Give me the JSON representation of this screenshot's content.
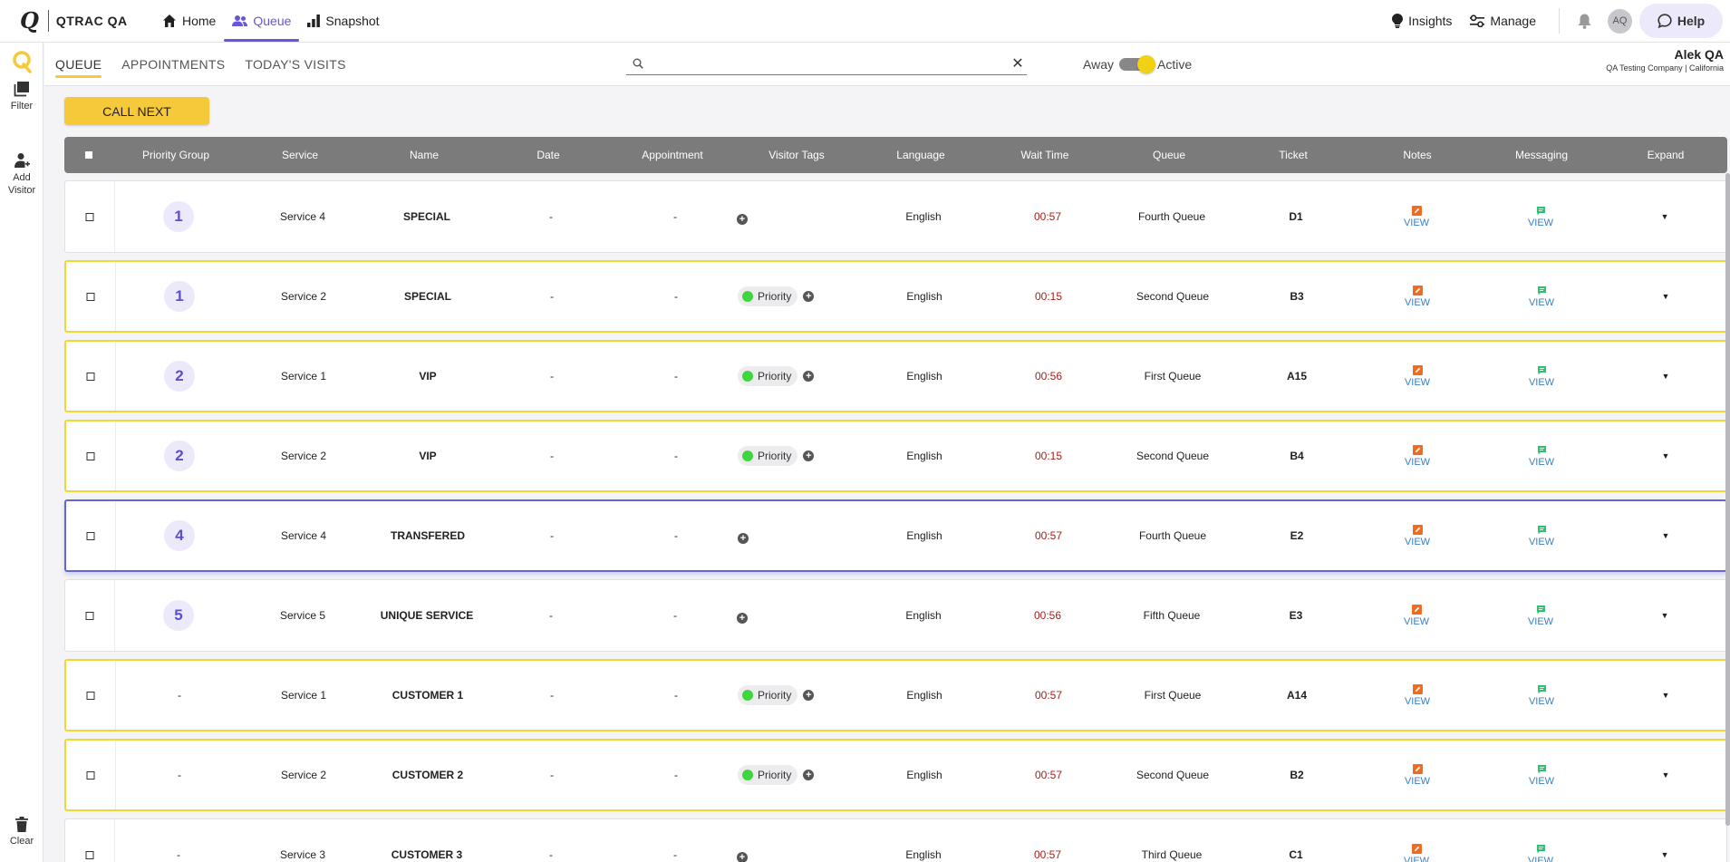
{
  "app": {
    "brand_letter": "Q",
    "brand_name": "QTRAC QA"
  },
  "nav": {
    "home": "Home",
    "queue": "Queue",
    "snapshot": "Snapshot"
  },
  "topbar": {
    "insights": "Insights",
    "manage": "Manage",
    "avatar_initials": "AQ",
    "help": "Help"
  },
  "rail": {
    "filter": "Filter",
    "add_visitor_line1": "Add",
    "add_visitor_line2": "Visitor",
    "clear": "Clear"
  },
  "tabs": {
    "queue": "QUEUE",
    "appointments": "APPOINTMENTS",
    "todays_visits": "TODAY'S VISITS"
  },
  "search": {
    "value": "",
    "placeholder": "",
    "clear_symbol": "✕"
  },
  "status": {
    "away": "Away",
    "active": "Active"
  },
  "user": {
    "name": "Alek QA",
    "org": "QA Testing Company | California"
  },
  "actions": {
    "call_next": "CALL NEXT"
  },
  "table": {
    "columns": {
      "priority_group": "Priority Group",
      "service": "Service",
      "name": "Name",
      "date": "Date",
      "appointment": "Appointment",
      "visitor_tags": "Visitor Tags",
      "language": "Language",
      "wait_time": "Wait Time",
      "queue": "Queue",
      "ticket": "Ticket",
      "notes": "Notes",
      "messaging": "Messaging",
      "expand": "Expand"
    },
    "view_label": "VIEW",
    "expand_symbol": "▼",
    "tag_add_symbol": "+",
    "rows": [
      {
        "priority": "1",
        "service": "Service 4",
        "name": "SPECIAL",
        "date": "-",
        "appointment": "-",
        "tag": "",
        "language": "English",
        "wait": "00:57",
        "queue": "Fourth Queue",
        "ticket": "D1",
        "style": "normal"
      },
      {
        "priority": "1",
        "service": "Service 2",
        "name": "SPECIAL",
        "date": "-",
        "appointment": "-",
        "tag": "Priority",
        "language": "English",
        "wait": "00:15",
        "queue": "Second Queue",
        "ticket": "B3",
        "style": "highlight"
      },
      {
        "priority": "2",
        "service": "Service 1",
        "name": "VIP",
        "date": "-",
        "appointment": "-",
        "tag": "Priority",
        "language": "English",
        "wait": "00:56",
        "queue": "First Queue",
        "ticket": "A15",
        "style": "highlight"
      },
      {
        "priority": "2",
        "service": "Service 2",
        "name": "VIP",
        "date": "-",
        "appointment": "-",
        "tag": "Priority",
        "language": "English",
        "wait": "00:15",
        "queue": "Second Queue",
        "ticket": "B4",
        "style": "highlight"
      },
      {
        "priority": "4",
        "service": "Service 4",
        "name": "TRANSFERED",
        "date": "-",
        "appointment": "-",
        "tag": "",
        "language": "English",
        "wait": "00:57",
        "queue": "Fourth Queue",
        "ticket": "E2",
        "style": "selected"
      },
      {
        "priority": "5",
        "service": "Service 5",
        "name": "UNIQUE SERVICE",
        "date": "-",
        "appointment": "-",
        "tag": "",
        "language": "English",
        "wait": "00:56",
        "queue": "Fifth Queue",
        "ticket": "E3",
        "style": "normal"
      },
      {
        "priority": "-",
        "service": "Service 1",
        "name": "CUSTOMER 1",
        "date": "-",
        "appointment": "-",
        "tag": "Priority",
        "language": "English",
        "wait": "00:57",
        "queue": "First Queue",
        "ticket": "A14",
        "style": "highlight"
      },
      {
        "priority": "-",
        "service": "Service 2",
        "name": "CUSTOMER 2",
        "date": "-",
        "appointment": "-",
        "tag": "Priority",
        "language": "English",
        "wait": "00:57",
        "queue": "Second Queue",
        "ticket": "B2",
        "style": "highlight"
      },
      {
        "priority": "-",
        "service": "Service 3",
        "name": "CUSTOMER 3",
        "date": "-",
        "appointment": "-",
        "tag": "",
        "language": "English",
        "wait": "00:57",
        "queue": "Third Queue",
        "ticket": "C1",
        "style": "normal"
      }
    ]
  },
  "colors": {
    "accent": "#6657d6",
    "call_next": "#f6c93a",
    "row_highlight": "#f2d733",
    "row_selected": "#6266d9",
    "wait_time": "#a32020",
    "tag_dot": "#3fd63f",
    "notes_icon": "#f26a1b",
    "messaging_icon": "#2fbf71",
    "view_link": "#3a7ec4"
  },
  "icons": {
    "home": "home-icon",
    "queue": "people-icon",
    "snapshot": "bar-chart-icon",
    "insights": "lightbulb-icon",
    "manage": "sliders-icon",
    "notifications": "bell-icon",
    "help": "chat-bubble-icon",
    "filter": "stack-icon",
    "add_visitor": "person-add-icon",
    "clear": "trash-icon",
    "search": "search-icon",
    "notes": "note-edit-icon",
    "messaging": "message-icon"
  }
}
